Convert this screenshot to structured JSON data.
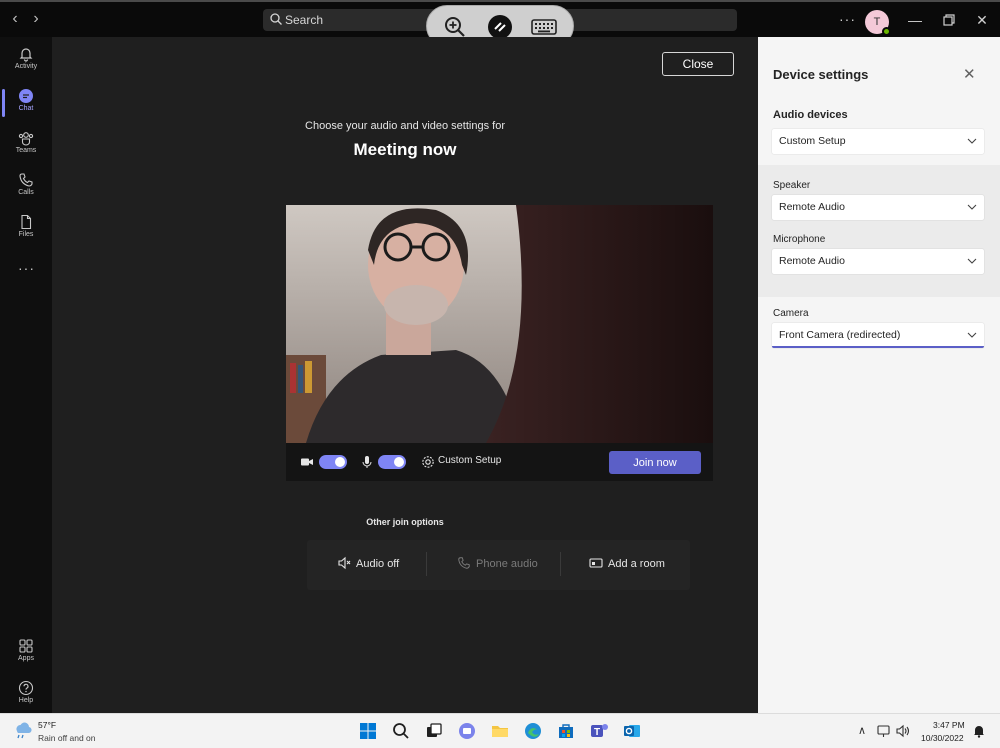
{
  "topbar": {
    "search_placeholder": "Search",
    "avatar_initial": "T",
    "more": "···"
  },
  "rail": {
    "items": [
      {
        "label": "Activity",
        "icon": "bell-icon"
      },
      {
        "label": "Chat",
        "icon": "chat-icon",
        "active": true
      },
      {
        "label": "Teams",
        "icon": "teams-icon"
      },
      {
        "label": "Calls",
        "icon": "phone-icon"
      },
      {
        "label": "Files",
        "icon": "file-icon"
      }
    ],
    "more": "···",
    "apps_label": "Apps",
    "help_label": "Help"
  },
  "stage": {
    "close_label": "Close",
    "subtitle": "Choose your audio and video settings for",
    "title": "Meeting now",
    "custom_setup_label": "Custom Setup",
    "join_label": "Join now",
    "other_options_title": "Other join options",
    "options": {
      "audio_off": "Audio off",
      "phone_audio": "Phone audio",
      "add_room": "Add a room"
    },
    "camera_on": true,
    "mic_on": true
  },
  "panel": {
    "title": "Device settings",
    "audio_devices_label": "Audio devices",
    "audio_devices_value": "Custom Setup",
    "speaker_label": "Speaker",
    "speaker_value": "Remote Audio",
    "microphone_label": "Microphone",
    "microphone_value": "Remote Audio",
    "camera_label": "Camera",
    "camera_value": "Front Camera (redirected)"
  },
  "taskbar": {
    "weather_temp": "57°F",
    "weather_desc": "Rain off and on",
    "time": "3:47 PM",
    "date": "10/30/2022"
  },
  "colors": {
    "accent": "#5b5fc7",
    "toggle": "#7f85f5",
    "presence": "#6bb700"
  }
}
